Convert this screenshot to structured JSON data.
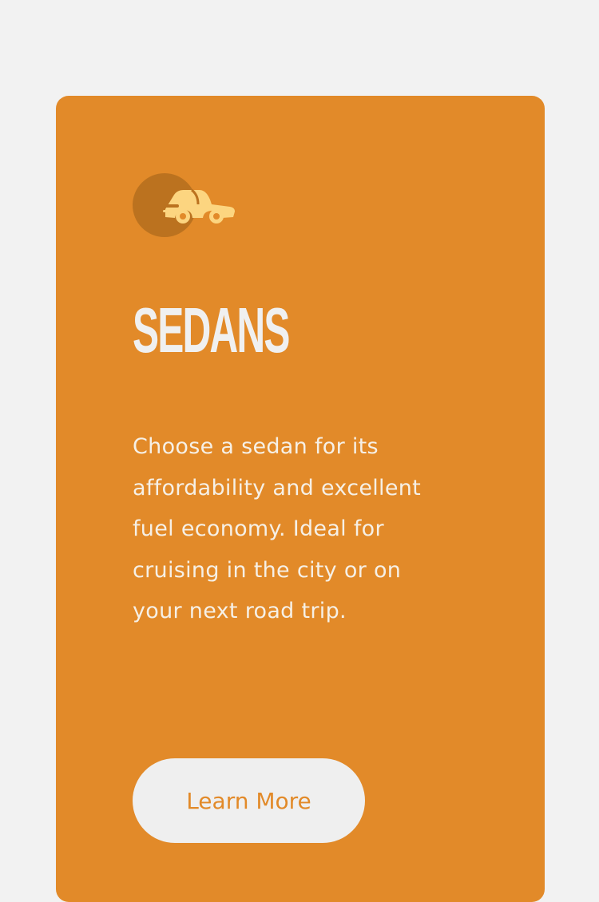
{
  "card": {
    "icon": "car-icon",
    "title": "SEDANS",
    "description": "Choose a sedan for its affordability and excellent fuel economy. Ideal for cruising in the city or on your next road trip.",
    "button_label": "Learn More"
  },
  "colors": {
    "page_background": "#f2f2f2",
    "card_background": "#e28a29",
    "icon_circle": "#bb721f",
    "icon_car": "#fcd580",
    "title_text": "#f0f0f0",
    "button_background": "#efefef",
    "button_text": "#e28a29"
  }
}
